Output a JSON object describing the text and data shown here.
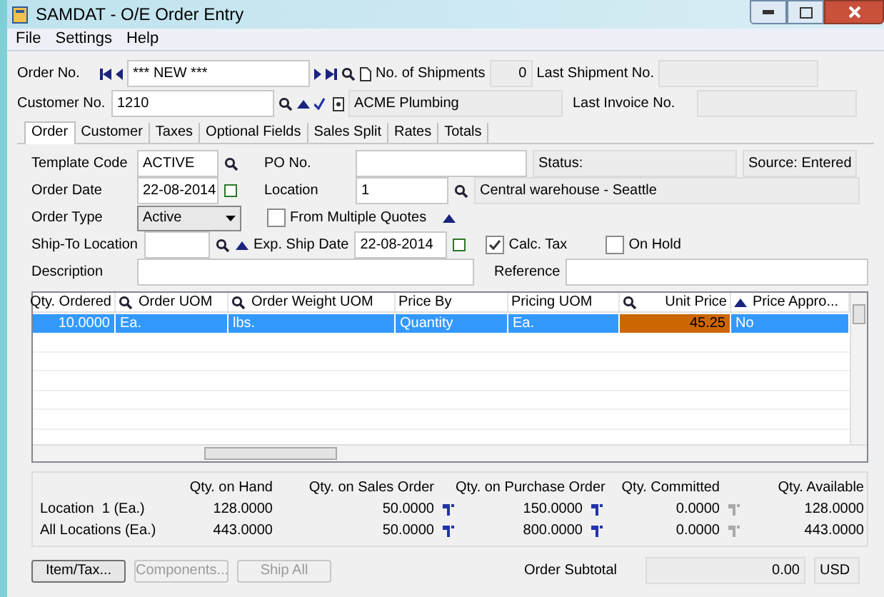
{
  "window": {
    "title": "SAMDAT - O/E Order Entry"
  },
  "menu": [
    "File",
    "Settings",
    "Help"
  ],
  "header": {
    "order_no_label": "Order No.",
    "order_no_value": "*** NEW ***",
    "shipments_label": "No. of Shipments",
    "shipments_value": "0",
    "last_shipment_label": "Last Shipment No.",
    "customer_no_label": "Customer No.",
    "customer_no_value": "1210",
    "customer_name": "ACME Plumbing",
    "last_invoice_label": "Last Invoice No."
  },
  "tabs": [
    {
      "label": "Order",
      "selected": true
    },
    {
      "label": "Customer",
      "selected": false
    },
    {
      "label": "Taxes",
      "selected": false
    },
    {
      "label": "Optional Fields",
      "selected": false
    },
    {
      "label": "Sales Split",
      "selected": false
    },
    {
      "label": "Rates",
      "selected": false
    },
    {
      "label": "Totals",
      "selected": false
    }
  ],
  "order": {
    "template_label": "Template Code",
    "template_value": "ACTIVE",
    "po_label": "PO No.",
    "status": "Status:",
    "source": "Source: Entered",
    "order_date_label": "Order Date",
    "order_date": "22-08-2014",
    "location_label": "Location",
    "location_value": "1",
    "location_name": "Central warehouse - Seattle",
    "order_type_label": "Order Type",
    "order_type": "Active",
    "from_quotes": {
      "label": "From Multiple Quotes",
      "checked": false
    },
    "ship_to_label": "Ship-To Location",
    "exp_ship_label": "Exp. Ship Date",
    "exp_ship_date": "22-08-2014",
    "calc_tax": {
      "label": "Calc. Tax",
      "checked": true
    },
    "on_hold": {
      "label": "On Hold",
      "checked": false
    },
    "description_label": "Description",
    "reference_label": "Reference"
  },
  "grid": {
    "columns": [
      {
        "label": "Qty. Ordered",
        "kind": "plain"
      },
      {
        "label": "Order UOM",
        "kind": "lookup"
      },
      {
        "label": "Order Weight UOM",
        "kind": "lookup"
      },
      {
        "label": "Price By",
        "kind": "plain"
      },
      {
        "label": "Pricing UOM",
        "kind": "plain"
      },
      {
        "label": "Unit Price",
        "kind": "lookup"
      },
      {
        "label": "Price Appro...",
        "kind": "drill"
      }
    ],
    "rows": [
      {
        "selected": true,
        "cells": [
          {
            "text": "10.0000",
            "focused": false
          },
          {
            "text": "Ea.",
            "focused": false
          },
          {
            "text": "lbs.",
            "focused": false
          },
          {
            "text": "Quantity",
            "focused": false
          },
          {
            "text": "Ea.",
            "focused": false
          },
          {
            "text": "45.25",
            "focused": true
          },
          {
            "text": "No",
            "focused": false
          }
        ]
      }
    ]
  },
  "summary": {
    "columns": [
      "Qty. on Hand",
      "Qty. on Sales Order",
      "Qty. on Purchase Order",
      "Qty. Committed",
      "Qty. Available"
    ],
    "rows": [
      {
        "label": "Location  1 (Ea.)",
        "values": [
          {
            "text": "128.0000",
            "kind": "plain"
          },
          {
            "text": "50.0000",
            "kind": "drill"
          },
          {
            "text": "150.0000",
            "kind": "drill"
          },
          {
            "text": "0.0000",
            "kind": "drill-disabled"
          },
          {
            "text": "128.0000",
            "kind": "plain"
          }
        ]
      },
      {
        "label": "All Locations (Ea.)",
        "values": [
          {
            "text": "443.0000",
            "kind": "plain"
          },
          {
            "text": "50.0000",
            "kind": "drill"
          },
          {
            "text": "800.0000",
            "kind": "drill"
          },
          {
            "text": "0.0000",
            "kind": "drill-disabled"
          },
          {
            "text": "443.0000",
            "kind": "plain"
          }
        ]
      }
    ]
  },
  "buttons": [
    {
      "label": "Item/Tax...",
      "disabled": false
    },
    {
      "label": "Components...",
      "disabled": true
    },
    {
      "label": "Ship All",
      "disabled": true
    }
  ],
  "subtotal": {
    "label": "Order Subtotal",
    "value": "0.00",
    "currency": "USD"
  }
}
